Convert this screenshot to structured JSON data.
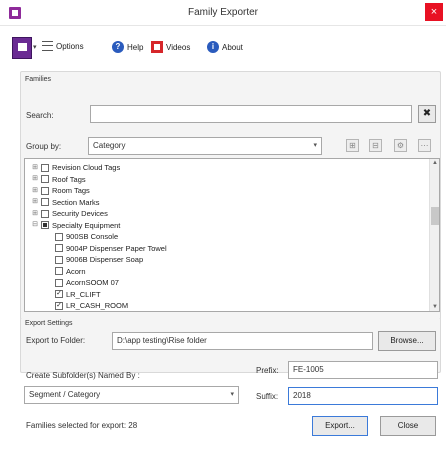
{
  "window": {
    "title": "Family Exporter",
    "close_label": "×"
  },
  "toolbar": {
    "chevron": "▾",
    "options_label": "Options",
    "help_label": "Help",
    "videos_label": "Videos",
    "about_label": "About",
    "help_glyph": "?",
    "about_glyph": "i"
  },
  "families": {
    "group_label": "Families",
    "search_label": "Search:",
    "search_value": "",
    "search_clear": "✖",
    "group_by_label": "Group by:",
    "group_by_value": "Category",
    "group_by_arrow": "▾",
    "tree": [
      {
        "label": "Revision Cloud Tags",
        "expander": "⊞",
        "state": "unchecked",
        "level": 0
      },
      {
        "label": "Roof Tags",
        "expander": "⊞",
        "state": "unchecked",
        "level": 0
      },
      {
        "label": "Room Tags",
        "expander": "⊞",
        "state": "unchecked",
        "level": 0
      },
      {
        "label": "Section Marks",
        "expander": "⊞",
        "state": "unchecked",
        "level": 0
      },
      {
        "label": "Security Devices",
        "expander": "⊞",
        "state": "unchecked",
        "level": 0
      },
      {
        "label": "Specialty Equipment",
        "expander": "⊟",
        "state": "mixed",
        "level": 0
      },
      {
        "label": "900SB Console",
        "expander": "",
        "state": "unchecked",
        "level": 1
      },
      {
        "label": "9004P Dispenser Paper Towel",
        "expander": "",
        "state": "unchecked",
        "level": 1
      },
      {
        "label": "9006B Dispenser Soap",
        "expander": "",
        "state": "unchecked",
        "level": 1
      },
      {
        "label": "Acorn",
        "expander": "",
        "state": "unchecked",
        "level": 1
      },
      {
        "label": "AcornSOOM 07",
        "expander": "",
        "state": "unchecked",
        "level": 1
      },
      {
        "label": "LR_CLIFT",
        "expander": "",
        "state": "checked",
        "level": 1
      },
      {
        "label": "LR_CASH_ROOM",
        "expander": "",
        "state": "checked",
        "level": 1
      }
    ]
  },
  "export_settings": {
    "group_label": "Export Settings",
    "folder_label": "Export to Folder:",
    "folder_value": "D:\\app testing\\Rise folder",
    "browse_label": "Browse...",
    "subfolders_label": "Create Subfolder(s) Named By :",
    "subfolders_value": "Segment / Category",
    "subfolders_arrow": "▾",
    "prefix_label": "Prefix:",
    "prefix_value": "FE-1005",
    "suffix_label": "Suffix:",
    "suffix_value": "2018"
  },
  "footer": {
    "status": "Families selected for export: 28",
    "export_label": "Export...",
    "close_label": "Close"
  }
}
